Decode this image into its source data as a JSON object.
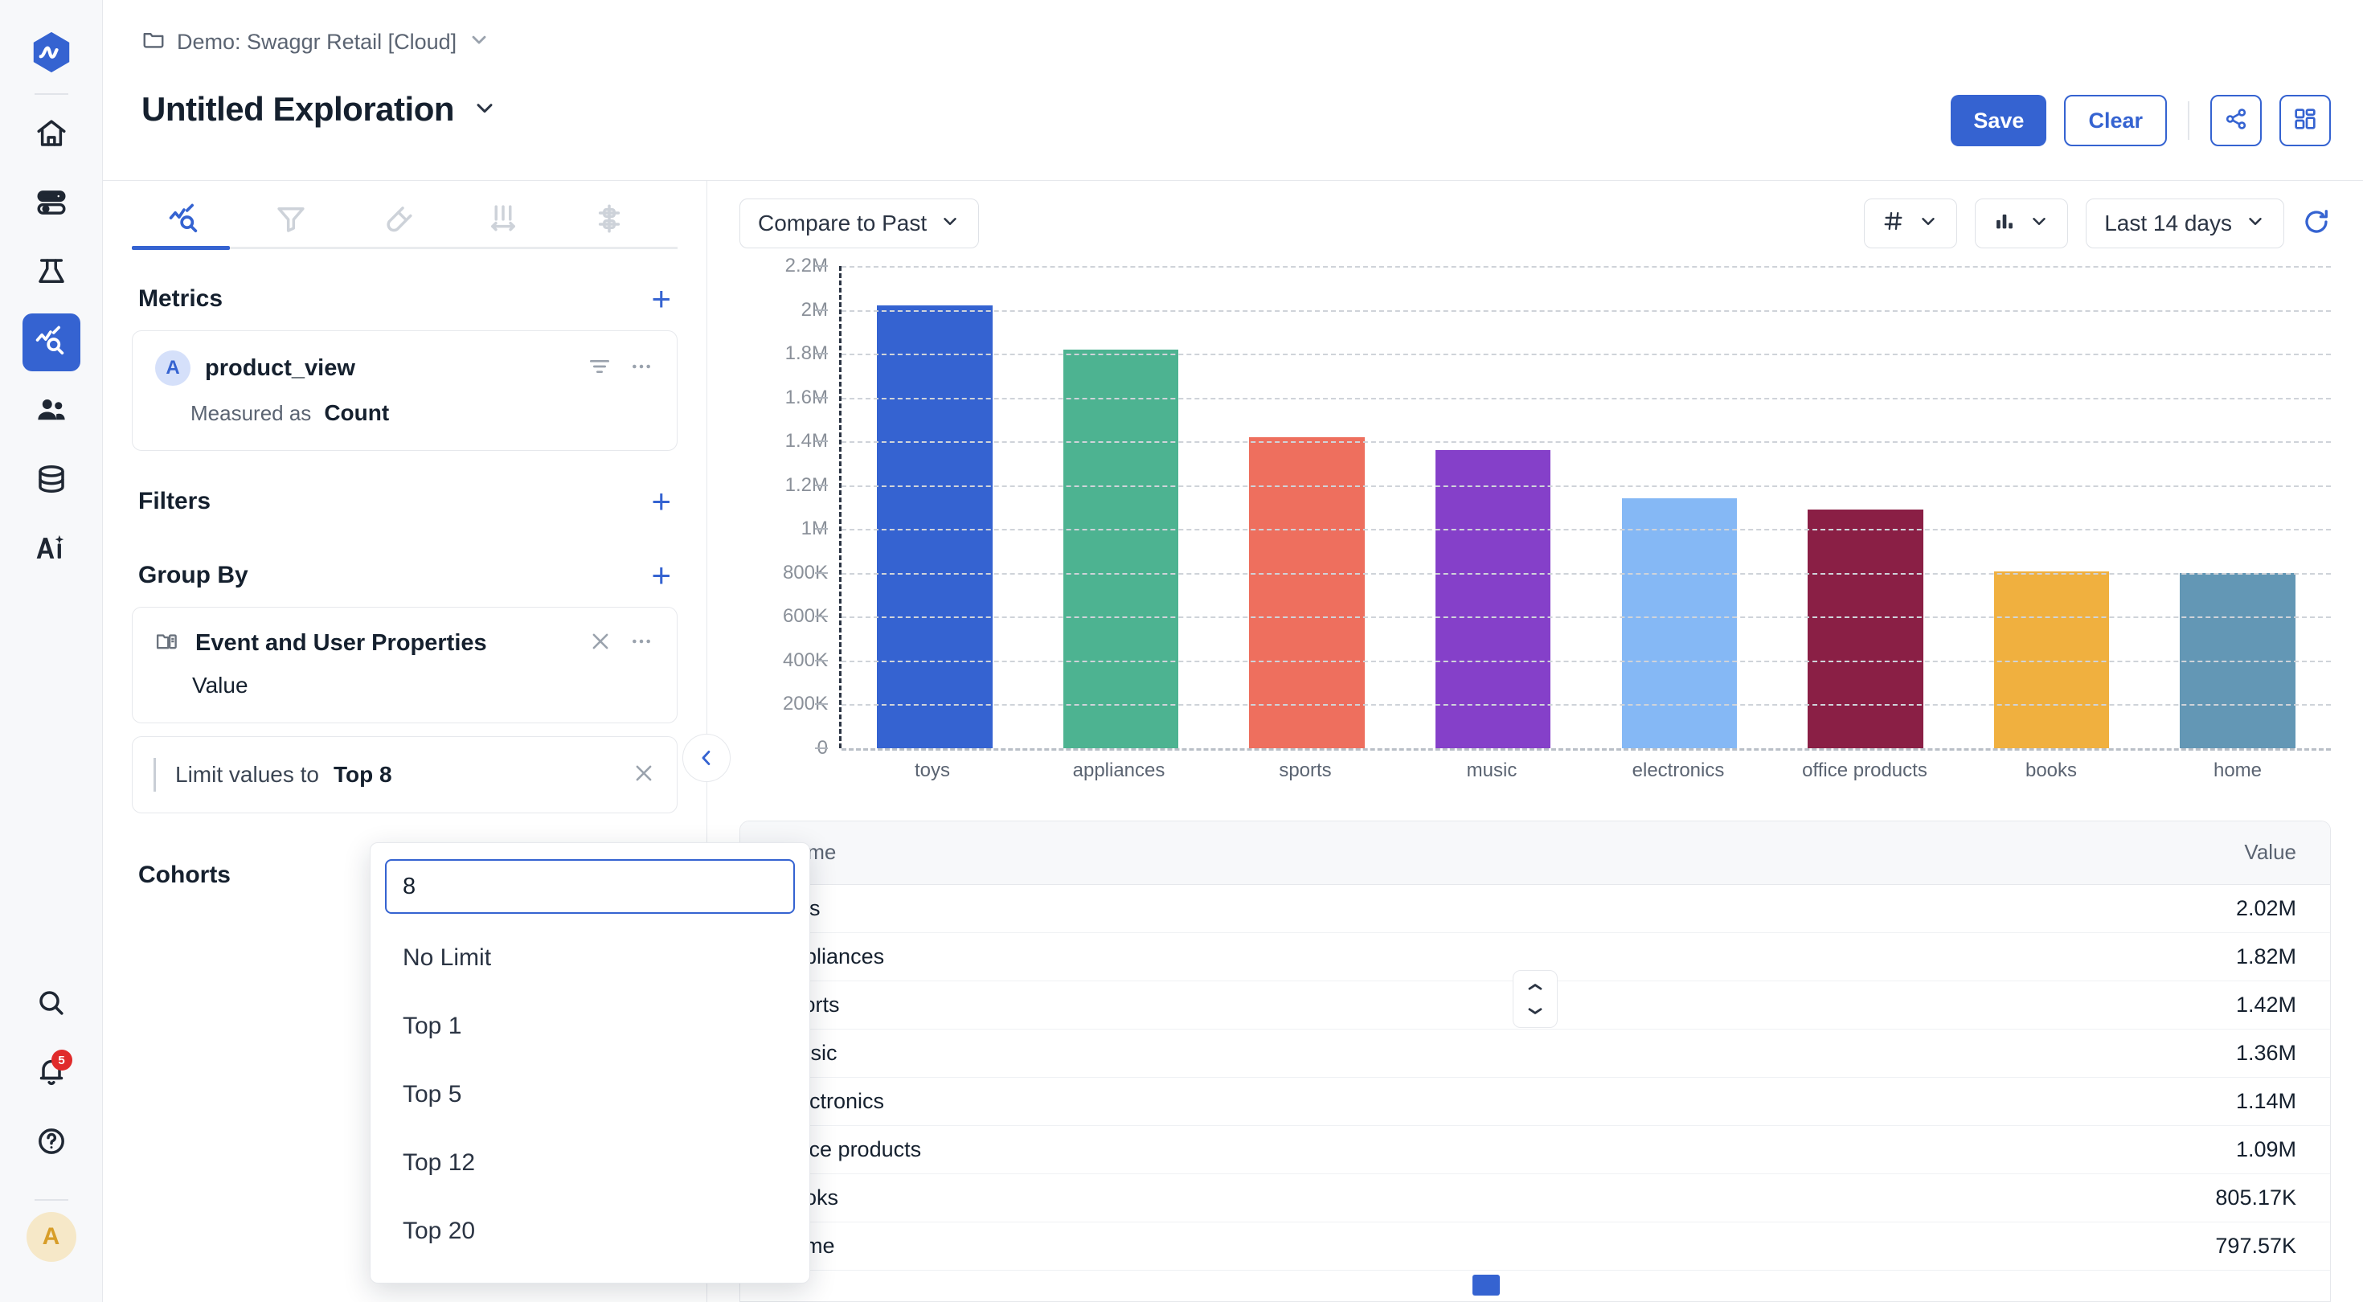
{
  "rail": {
    "logo": "amplitude-logo-icon",
    "items": [
      {
        "icon": "home-icon",
        "name": "home",
        "active": false
      },
      {
        "icon": "dashboard-toggles-icon",
        "name": "dashboards",
        "active": false
      },
      {
        "icon": "flask-experiment-icon",
        "name": "experiments",
        "active": false
      },
      {
        "icon": "analytics-chart-search-icon",
        "name": "analytics",
        "active": true
      },
      {
        "icon": "people-icon",
        "name": "audiences",
        "active": false
      },
      {
        "icon": "database-icon",
        "name": "data",
        "active": false
      },
      {
        "icon": "ai-text-icon",
        "name": "ai-assistant",
        "active": false
      }
    ],
    "bottom": [
      {
        "icon": "search-icon",
        "name": "search"
      },
      {
        "icon": "bell-icon",
        "name": "notifications",
        "badge": "5"
      },
      {
        "icon": "help-circle-icon",
        "name": "help"
      }
    ],
    "avatar_initial": "A"
  },
  "header": {
    "breadcrumb": "Demo: Swaggr Retail [Cloud]",
    "breadcrumb_icon": "folder-icon",
    "title": "Untitled Exploration",
    "save_label": "Save",
    "clear_label": "Clear",
    "share_icon": "share-icon",
    "layout_icon": "grid-layout-icon"
  },
  "panel": {
    "tabs": [
      {
        "icon": "analytics-chart-search-icon",
        "name": "events",
        "active": true
      },
      {
        "icon": "filter-funnel-icon",
        "name": "filters",
        "active": false
      },
      {
        "icon": "magnet-icon",
        "name": "attribution",
        "active": false
      },
      {
        "icon": "segments-icon",
        "name": "segments",
        "active": false
      },
      {
        "icon": "settings-sliders-icon",
        "name": "advanced",
        "active": false
      }
    ],
    "metrics": {
      "heading": "Metrics",
      "add_label": "+",
      "event": {
        "badge": "A",
        "name": "product_view",
        "measured_label": "Measured as",
        "measured_value": "Count"
      }
    },
    "filters": {
      "heading": "Filters",
      "add_label": "+"
    },
    "group_by": {
      "heading": "Group By",
      "add_label": "+",
      "property_icon": "properties-folder-icon",
      "property_name": "Event and User Properties",
      "property_value": "Value"
    },
    "limit": {
      "label": "Limit values to",
      "value": "Top 8"
    },
    "cohorts": {
      "heading": "Cohorts"
    }
  },
  "dropdown": {
    "input_value": "8",
    "placeholder": "",
    "options": [
      "No Limit",
      "Top 1",
      "Top 5",
      "Top 12",
      "Top 20"
    ]
  },
  "chart_toolbar": {
    "compare_label": "Compare to Past",
    "format_icon": "hash-icon",
    "chart_type_icon": "bar-chart-icon",
    "date_range": "Last 14 days",
    "refresh_icon": "refresh-icon"
  },
  "table": {
    "columns": [
      "Name",
      "Value"
    ],
    "rows": [
      {
        "name": "toys",
        "value": "2.02M",
        "color": "#3563d1"
      },
      {
        "name": "appliances",
        "value": "1.82M",
        "color": "#4db391"
      },
      {
        "name": "sports",
        "value": "1.42M",
        "color": "#ee6f5e"
      },
      {
        "name": "music",
        "value": "1.36M",
        "color": "#8540c9"
      },
      {
        "name": "electronics",
        "value": "1.14M",
        "color": "#85b8f5"
      },
      {
        "name": "office products",
        "value": "1.09M",
        "color": "#8a1f45"
      },
      {
        "name": "books",
        "value": "805.17K",
        "color": "#f0b03f"
      },
      {
        "name": "home",
        "value": "797.57K",
        "color": "#6397b5"
      }
    ]
  },
  "chart_data": {
    "type": "bar",
    "title": "",
    "xlabel": "",
    "ylabel": "",
    "categories": [
      "toys",
      "appliances",
      "sports",
      "music",
      "electronics",
      "office products",
      "books",
      "home"
    ],
    "values": [
      2020000,
      1820000,
      1420000,
      1360000,
      1140000,
      1090000,
      805170,
      797570
    ],
    "value_labels": [
      "2.02M",
      "1.82M",
      "1.42M",
      "1.36M",
      "1.14M",
      "1.09M",
      "805.17K",
      "797.57K"
    ],
    "colors": [
      "#3563d1",
      "#4db391",
      "#ee6f5e",
      "#8540c9",
      "#85b8f5",
      "#8a1f45",
      "#f0b03f",
      "#6397b5"
    ],
    "ylim": [
      0,
      2200000
    ],
    "ytick_labels": [
      "2.2M",
      "2M",
      "1.8M",
      "1.6M",
      "1.4M",
      "1.2M",
      "1M",
      "800K",
      "600K",
      "400K",
      "200K",
      "0"
    ],
    "ytick_values": [
      2200000,
      2000000,
      1800000,
      1600000,
      1400000,
      1200000,
      1000000,
      800000,
      600000,
      400000,
      200000,
      0
    ],
    "grid": true,
    "legend": false
  }
}
